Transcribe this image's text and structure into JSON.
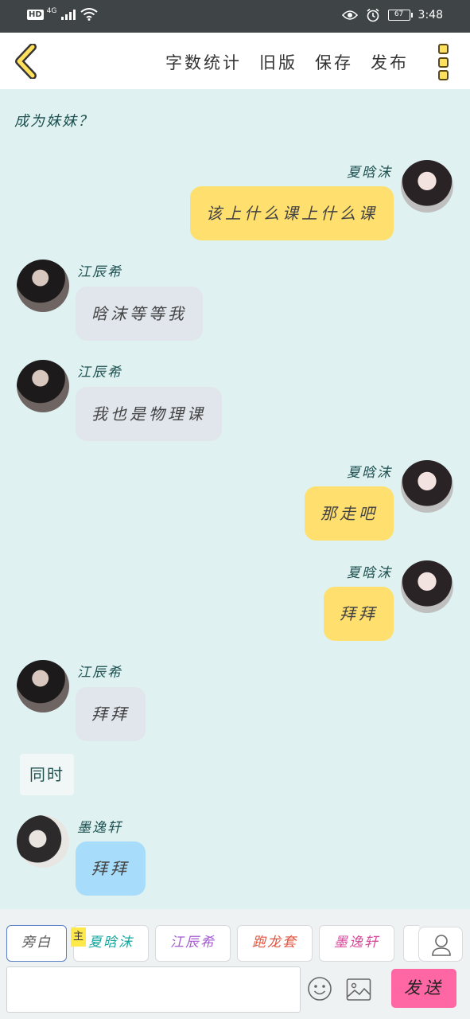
{
  "status_bar": {
    "hd": "HD",
    "network": "4G",
    "battery": "67",
    "time": "3:48"
  },
  "header": {
    "actions": [
      "字数统计",
      "旧版",
      "保存",
      "发布"
    ]
  },
  "narration_top": "成为妹妹？",
  "messages": [
    {
      "speaker": "夏晗沫",
      "text": "该上什么课上什么课",
      "side": "right"
    },
    {
      "speaker": "江辰希",
      "text": "晗沫等等我",
      "side": "left"
    },
    {
      "speaker": "江辰希",
      "text": "我也是物理课",
      "side": "left"
    },
    {
      "speaker": "夏晗沫",
      "text": "那走吧",
      "side": "right"
    },
    {
      "speaker": "夏晗沫",
      "text": "拜拜",
      "side": "right"
    },
    {
      "speaker": "江辰希",
      "text": "拜拜",
      "side": "left"
    },
    {
      "speaker": "墨逸轩",
      "text": "拜拜",
      "side": "left"
    }
  ],
  "narration_mid": "同时",
  "roles": [
    {
      "label": "旁白",
      "color": "#555555"
    },
    {
      "label": "夏晗沫",
      "color": "#16a79e"
    },
    {
      "label": "江辰希",
      "color": "#a45bd0"
    },
    {
      "label": "跑龙套",
      "color": "#e0533e"
    },
    {
      "label": "墨逸轩",
      "color": "#d84a9a"
    }
  ],
  "main_tag": "主",
  "input": {
    "value": "",
    "placeholder": ""
  },
  "send_label": "发送",
  "colors": {
    "accent_yellow": "#ffdf6e",
    "send_pink": "#ff66a4",
    "chat_bg": "#dff1f1"
  }
}
